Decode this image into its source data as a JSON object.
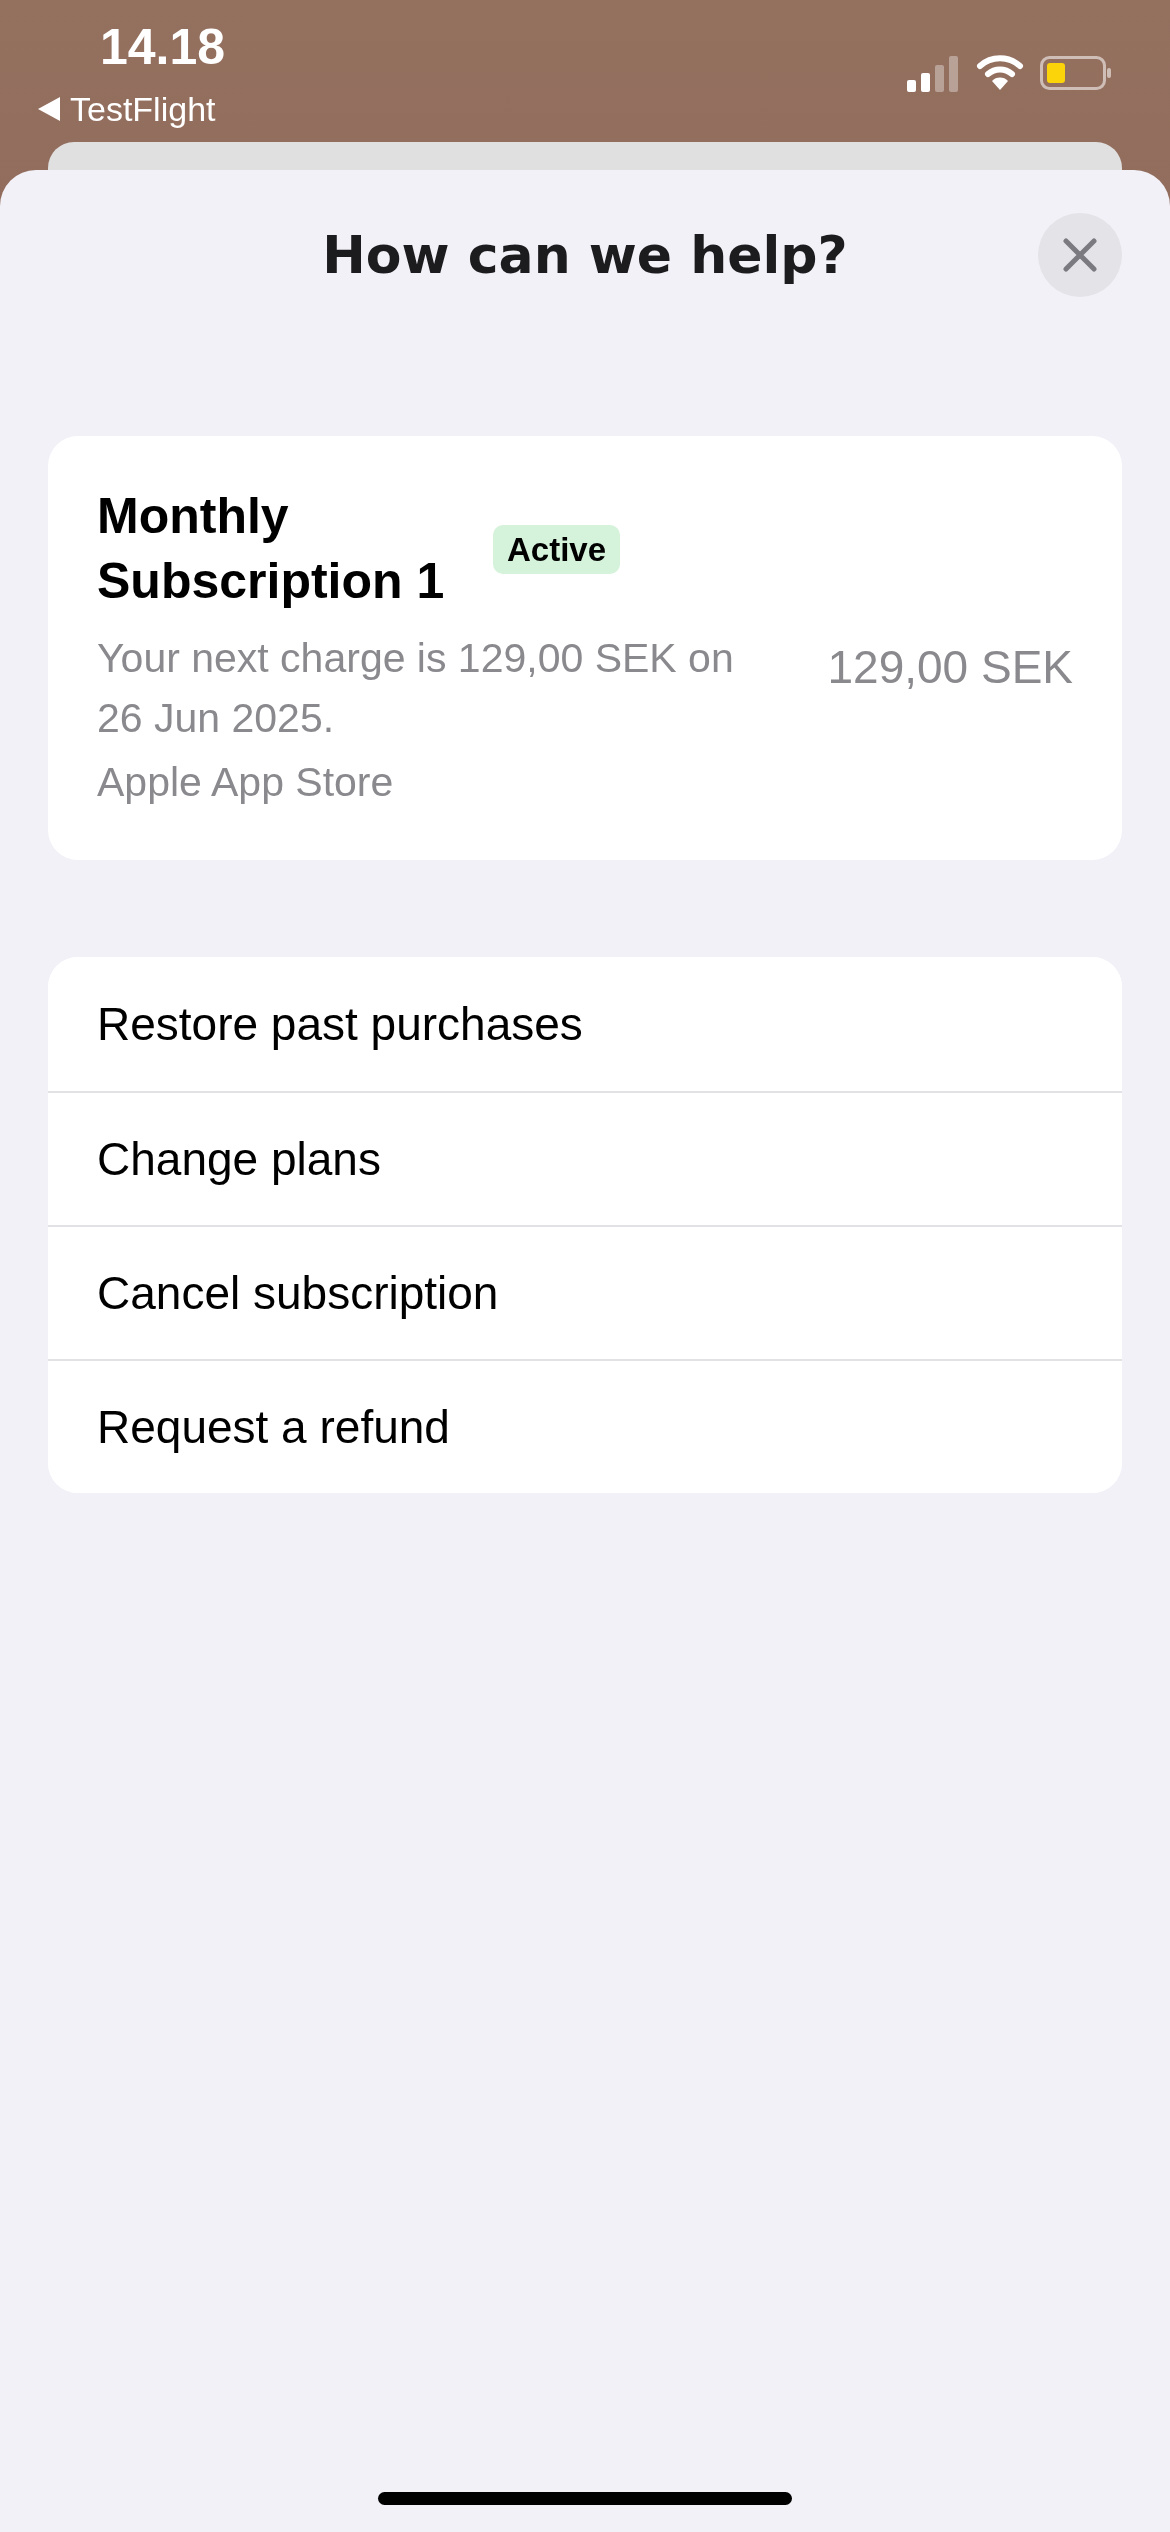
{
  "status_bar": {
    "time": "14.18",
    "back_app": "TestFlight"
  },
  "sheet": {
    "title": "How can we help?"
  },
  "subscription": {
    "name": "Monthly Subscription 1",
    "status": "Active",
    "description": "Your next charge is 129,00 SEK on 26 Jun 2025.",
    "source": "Apple App Store",
    "price": "129,00 SEK"
  },
  "actions": [
    {
      "label": "Restore past purchases"
    },
    {
      "label": "Change plans"
    },
    {
      "label": "Cancel subscription"
    },
    {
      "label": "Request a refund"
    }
  ]
}
